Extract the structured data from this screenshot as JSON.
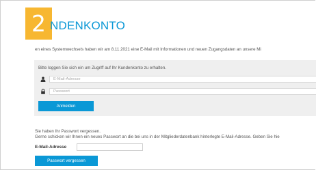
{
  "step": {
    "number": "2"
  },
  "page": {
    "title": "NDENKONTO",
    "notice": "en eines Systemwechsels haben wir am 8.11.2021 eine E-Mail mit Informationen und neuen Zugangsdaten an unsere Mi"
  },
  "login": {
    "intro": "Bitte loggen Sie sich ein um Zugriff auf Ihr Kundenkonto zu erhalten.",
    "email_placeholder": "E-Mail-Adresse",
    "password_placeholder": "Passwort",
    "submit_label": "Anmelden"
  },
  "forgot": {
    "line1": "Sie haben Ihr Passwort vergessen.",
    "line2": "Gerne schicken wir Ihnen ein neues Passwort an die bei uns in der Mitgliederdatenbank hinterlegte E-Mail-Adresse. Geben Sie hie",
    "email_label": "E-Mail-Adresse",
    "email_value": "",
    "submit_label": "Passwort vergessen"
  },
  "colors": {
    "accent": "#0a98d6",
    "badge": "#f7b731",
    "panel": "#efefef"
  },
  "icons": {
    "email_field": "user-icon",
    "password_field": "lock-icon"
  }
}
